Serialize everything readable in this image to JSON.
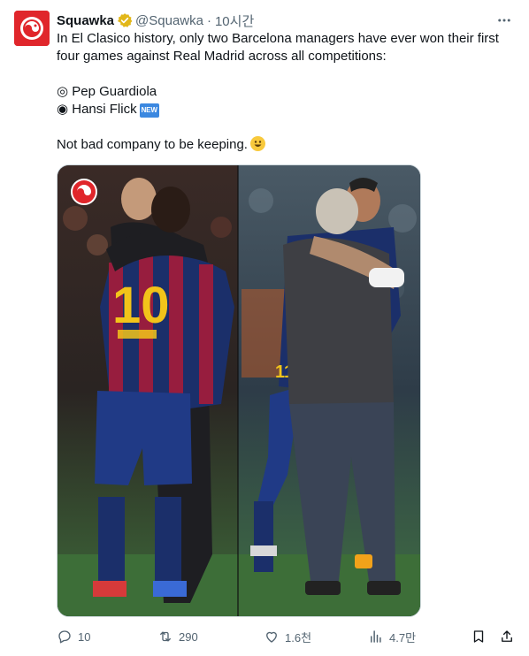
{
  "tweet": {
    "author_name": "Squawka",
    "author_handle": "@Squawka",
    "separator": "·",
    "timestamp": "10시간",
    "lines": [
      "In El Clasico history, only two Barcelona managers have ever won their first",
      "four games against Real Madrid across all competitions:"
    ],
    "bullet_1": "◎ Pep Guardiola",
    "bullet_2": "◉ Hansi Flick",
    "new_badge": "NEW",
    "closing": "Not bad company to be keeping.",
    "image_shirt_number_left": "10",
    "image_shirt_number_right": "11"
  },
  "actions": {
    "replies": "10",
    "reposts": "290",
    "likes": "1.6천",
    "views": "4.7만"
  },
  "colors": {
    "brand_red": "#e0262b",
    "verified_gold": "#e2b719",
    "muted_text": "#536471"
  },
  "icons": [
    "squawka-logo-icon",
    "verified-badge-icon",
    "more-options-icon",
    "reply-icon",
    "repost-icon",
    "like-icon",
    "views-icon",
    "bookmark-icon",
    "share-icon"
  ]
}
